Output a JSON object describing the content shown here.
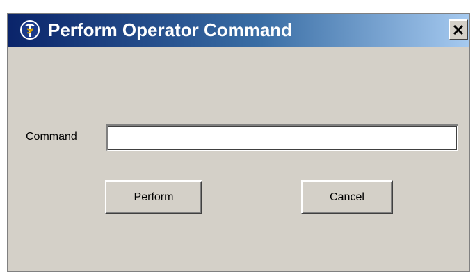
{
  "window": {
    "title": "Perform Operator Command",
    "close_label": "Close",
    "app_icon": "medical-caduceus-icon"
  },
  "form": {
    "command_label": "Command",
    "command_value": "",
    "command_placeholder": ""
  },
  "buttons": {
    "perform_label": "Perform",
    "cancel_label": "Cancel"
  },
  "colors": {
    "titlebar_start": "#0a246a",
    "titlebar_end": "#a6caf0",
    "dialog_background": "#d4d0c8"
  }
}
